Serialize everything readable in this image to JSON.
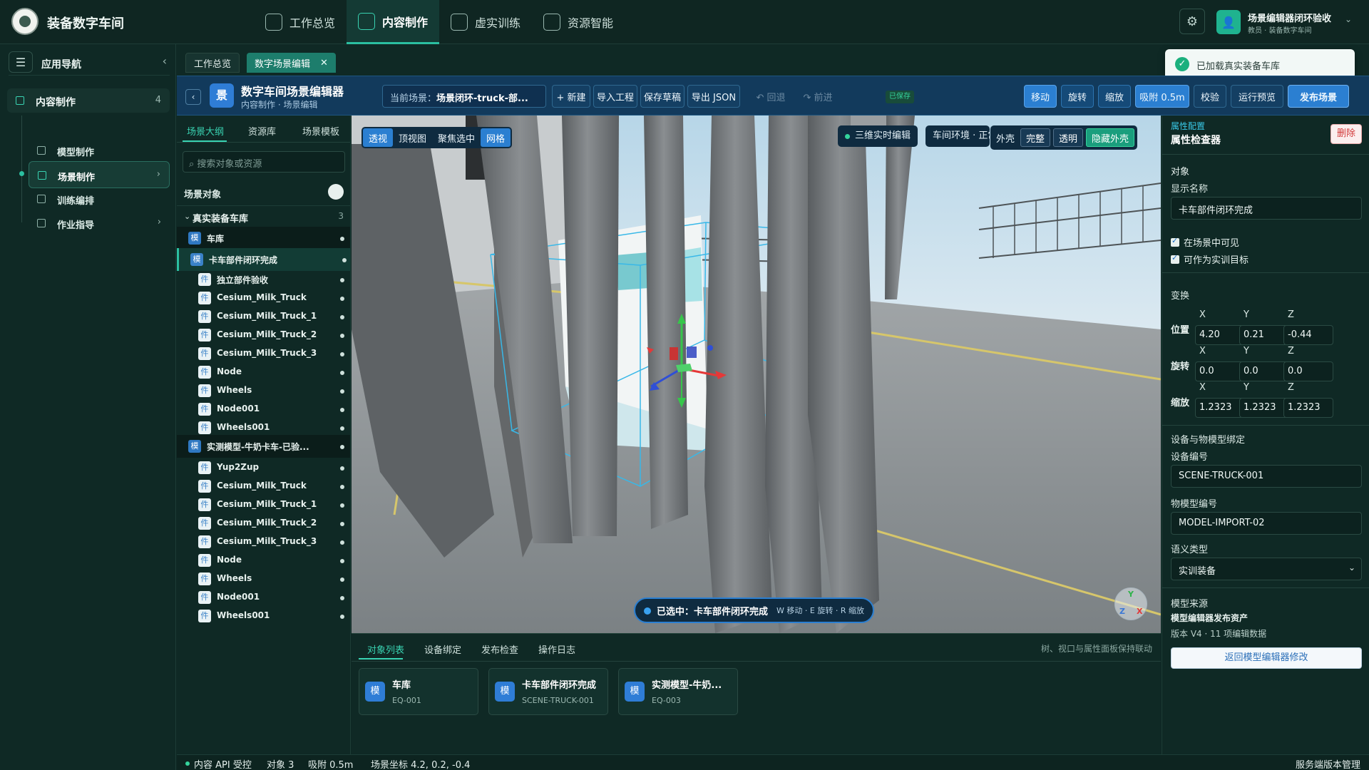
{
  "app": {
    "title": "装备数字车间"
  },
  "topnav": [
    {
      "label": "工作总览",
      "icon": "dashboard-icon"
    },
    {
      "label": "内容制作",
      "icon": "cube-icon"
    },
    {
      "label": "虚实训练",
      "icon": "book-icon"
    },
    {
      "label": "资源智能",
      "icon": "ai-icon"
    }
  ],
  "user": {
    "name": "场景编辑器闭环验收",
    "role": "教员 · 装备数字车间"
  },
  "leftnav": {
    "title": "应用导航",
    "group": {
      "label": "内容制作",
      "count": "4"
    },
    "items": [
      {
        "label": "模型制作"
      },
      {
        "label": "场景制作"
      },
      {
        "label": "训练编排"
      },
      {
        "label": "作业指导"
      }
    ]
  },
  "page_tabs": [
    {
      "label": "工作总览"
    },
    {
      "label": "数字场景编辑"
    }
  ],
  "toast": {
    "message": "已加载真实装备车库"
  },
  "editor": {
    "icon_char": "景",
    "title": "数字车间场景编辑器",
    "subtitle": "内容制作 · 场景编辑",
    "scene_label": "当前场景：",
    "scene_value": "场景闭环-truck-部...",
    "new_label": "+ 新建",
    "import_label": "导入工程",
    "save_label": "保存草稿",
    "export_label": "导出 JSON",
    "undo_label": "↶ 回退",
    "redo_label": "↷ 前进",
    "saved_badge": "已保存",
    "move_label": "移动",
    "rotate_label": "旋转",
    "scale_label": "缩放",
    "snap_label": "吸附 0.5m",
    "validate_label": "校验",
    "preview_label": "运行预览",
    "publish_label": "发布场景"
  },
  "outline": {
    "tabs": [
      {
        "label": "场景大纲"
      },
      {
        "label": "资源库"
      },
      {
        "label": "场景模板"
      }
    ],
    "search_placeholder": "搜索对象或资源",
    "section_title": "场景对象",
    "group_label": "真实装备车库",
    "group_count": "3",
    "rows": [
      {
        "badge": "模",
        "label": "车库",
        "kind": "root"
      },
      {
        "badge": "模",
        "label": "卡车部件闭环完成",
        "kind": "sel"
      },
      {
        "badge": "件",
        "label": "独立部件验收",
        "kind": "child"
      },
      {
        "badge": "件",
        "label": "Cesium_Milk_Truck",
        "kind": "child"
      },
      {
        "badge": "件",
        "label": "Cesium_Milk_Truck_1",
        "kind": "child"
      },
      {
        "badge": "件",
        "label": "Cesium_Milk_Truck_2",
        "kind": "child"
      },
      {
        "badge": "件",
        "label": "Cesium_Milk_Truck_3",
        "kind": "child"
      },
      {
        "badge": "件",
        "label": "Node",
        "kind": "child"
      },
      {
        "badge": "件",
        "label": "Wheels",
        "kind": "child"
      },
      {
        "badge": "件",
        "label": "Node001",
        "kind": "child"
      },
      {
        "badge": "件",
        "label": "Wheels001",
        "kind": "child"
      },
      {
        "badge": "模",
        "label": "实测模型-牛奶卡车-已验...",
        "kind": "root"
      },
      {
        "badge": "件",
        "label": "Yup2Zup",
        "kind": "child"
      },
      {
        "badge": "件",
        "label": "Cesium_Milk_Truck",
        "kind": "child"
      },
      {
        "badge": "件",
        "label": "Cesium_Milk_Truck_1",
        "kind": "child"
      },
      {
        "badge": "件",
        "label": "Cesium_Milk_Truck_2",
        "kind": "child"
      },
      {
        "badge": "件",
        "label": "Cesium_Milk_Truck_3",
        "kind": "child"
      },
      {
        "badge": "件",
        "label": "Node",
        "kind": "child"
      },
      {
        "badge": "件",
        "label": "Wheels",
        "kind": "child"
      },
      {
        "badge": "件",
        "label": "Node001",
        "kind": "child"
      },
      {
        "badge": "件",
        "label": "Wheels001",
        "kind": "child"
      }
    ]
  },
  "viewport": {
    "view_buttons": [
      {
        "label": "透视"
      },
      {
        "label": "顶视图"
      },
      {
        "label": "聚焦选中"
      },
      {
        "label": "网格"
      }
    ],
    "live_label": "三维实时编辑",
    "env_label": "车间环境 · 正常",
    "shell_label": "外壳",
    "shell_buttons": [
      {
        "label": "完整"
      },
      {
        "label": "透明"
      },
      {
        "label": "隐藏外壳"
      }
    ],
    "selected_label": "已选中：卡车部件闭环完成",
    "shortcut_hint": "W 移动 · E 旋转 · R 缩放",
    "gizmo_y": "Y",
    "gizmo_z": "Z",
    "gizmo_x": "X"
  },
  "dock": {
    "tabs": [
      {
        "label": "对象列表"
      },
      {
        "label": "设备绑定"
      },
      {
        "label": "发布检查"
      },
      {
        "label": "操作日志"
      }
    ],
    "hint": "树、视口与属性面板保持联动",
    "cards": [
      {
        "icon": "模",
        "name": "车库",
        "code": "EQ-001"
      },
      {
        "icon": "模",
        "name": "卡车部件闭环完成",
        "code": "SCENE-TRUCK-001"
      },
      {
        "icon": "模",
        "name": "实测模型-牛奶...",
        "code": "EQ-003"
      }
    ]
  },
  "statusbar": {
    "api": "内容 API 受控",
    "objects": "对象 3",
    "snap": "吸附 0.5m",
    "coords": "场景坐标 4.2, 0.2, -0.4",
    "right": "服务端版本管理"
  },
  "props": {
    "subtitle": "属性配置",
    "title": "属性检查器",
    "delete_label": "删除",
    "object_section": "对象",
    "display_name_label": "显示名称",
    "display_name_value": "卡车部件闭环完成",
    "visible_label": "在场景中可见",
    "target_label": "可作为实训目标",
    "transform_section": "变换",
    "axis_x": "X",
    "axis_y": "Y",
    "axis_z": "Z",
    "position_label": "位置",
    "rotation_label": "旋转",
    "scale_label": "缩放",
    "position": [
      "4.20",
      "0.21",
      "-0.44"
    ],
    "rotation": [
      "0.0",
      "0.0",
      "0.0"
    ],
    "scale": [
      "1.2323",
      "1.2323",
      "1.2323"
    ],
    "binding_section": "设备与物模型绑定",
    "device_label": "设备编号",
    "device_value": "SCENE-TRUCK-001",
    "model_label": "物模型编号",
    "model_value": "MODEL-IMPORT-02",
    "semantic_label": "语义类型",
    "semantic_value": "实训装备",
    "source_section": "模型来源",
    "source_name": "模型编辑器发布资产",
    "source_version": "版本 V4 · 11 项编辑数据",
    "return_label": "返回模型编辑器修改"
  }
}
